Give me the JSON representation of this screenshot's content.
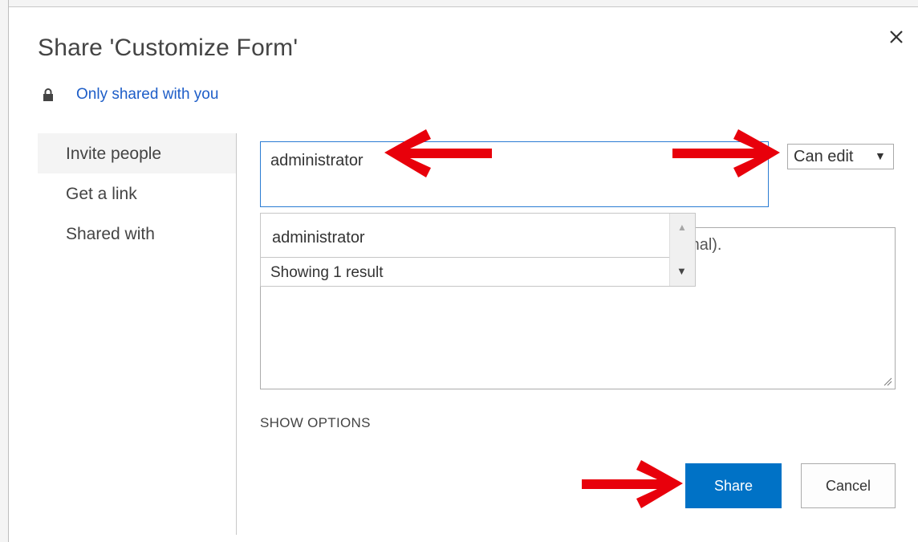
{
  "dialog": {
    "title": "Share 'Customize Form'",
    "close_icon": "close-icon"
  },
  "sharing_status": {
    "icon": "lock-icon",
    "label": "Only shared with you"
  },
  "nav": {
    "items": [
      {
        "label": "Invite people",
        "active": true
      },
      {
        "label": "Get a link",
        "active": false
      },
      {
        "label": "Shared with",
        "active": false
      }
    ]
  },
  "invite": {
    "value": "administrator",
    "permission": "Can edit"
  },
  "suggestions": {
    "items": [
      {
        "label": "administrator"
      }
    ],
    "count_text": "Showing 1 result"
  },
  "message": {
    "placeholder_visible": "ional)."
  },
  "options": {
    "label": "SHOW OPTIONS"
  },
  "actions": {
    "share_label": "Share",
    "cancel_label": "Cancel"
  },
  "annotations": {
    "arrow_color": "#e8000b"
  },
  "colors": {
    "accent": "#0072c6",
    "link": "#1e5ec8",
    "focus_border": "#2b7cd3"
  }
}
